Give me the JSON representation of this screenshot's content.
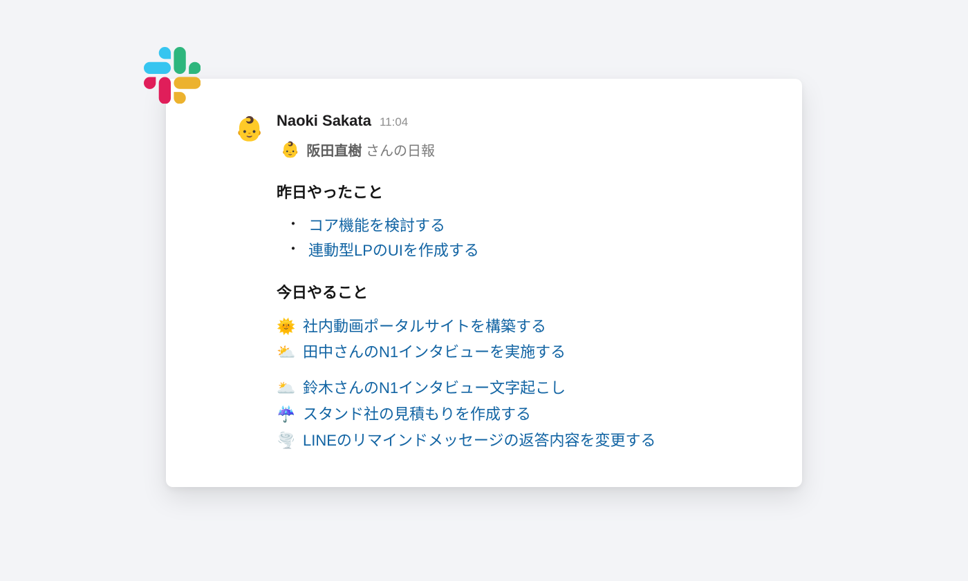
{
  "message": {
    "author": "Naoki Sakata",
    "timestamp": "11:04",
    "avatar_emoji": "👶",
    "report_header": {
      "mini_avatar_emoji": "👶",
      "name": "阪田直樹",
      "suffix": "さんの日報"
    },
    "sections": [
      {
        "title": "昨日やったこと",
        "type": "bullet",
        "items": [
          {
            "text": "コア機能を検討する"
          },
          {
            "text": "連動型LPのUIを作成する"
          }
        ]
      },
      {
        "title": "今日やること",
        "type": "emoji",
        "groups": [
          [
            {
              "emoji": "🌞",
              "text": "社内動画ポータルサイトを構築する"
            },
            {
              "emoji": "⛅",
              "text": "田中さんのN1インタビューを実施する"
            }
          ],
          [
            {
              "emoji": "🌥️",
              "text": "鈴木さんのN1インタビュー文字起こし"
            },
            {
              "emoji": "☔",
              "text": "スタンド社の見積もりを作成する"
            },
            {
              "emoji": "🌪️",
              "text": "LINEのリマインドメッセージの返答内容を変更する"
            }
          ]
        ]
      }
    ]
  }
}
